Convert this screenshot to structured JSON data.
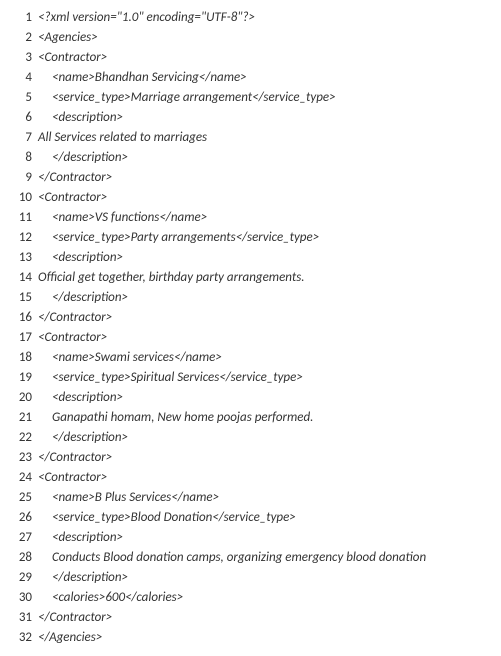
{
  "lines": [
    {
      "n": "1",
      "indent": 1,
      "text": "<?xml version=\"1.0\" encoding=\"UTF-8\"?>"
    },
    {
      "n": "2",
      "indent": 1,
      "text": "<Agencies>"
    },
    {
      "n": "3",
      "indent": 1,
      "text": "<Contractor>"
    },
    {
      "n": "4",
      "indent": 2,
      "text": "<name>Bhandhan Servicing</name>"
    },
    {
      "n": "5",
      "indent": 2,
      "text": "<service_type>Marriage arrangement</service_type>"
    },
    {
      "n": "6",
      "indent": 2,
      "text": "<description>"
    },
    {
      "n": "7",
      "indent": 1,
      "text": "All Services related to marriages"
    },
    {
      "n": "8",
      "indent": 2,
      "text": "</description>"
    },
    {
      "n": "9",
      "indent": 1,
      "text": "</Contractor>"
    },
    {
      "n": "10",
      "indent": 1,
      "text": "<Contractor>"
    },
    {
      "n": "11",
      "indent": 2,
      "text": "<name>VS functions</name>"
    },
    {
      "n": "12",
      "indent": 2,
      "text": "<service_type>Party arrangements</service_type>"
    },
    {
      "n": "13",
      "indent": 2,
      "text": "<description>"
    },
    {
      "n": "14",
      "indent": 1,
      "text": "Official get together, birthday party arrangements."
    },
    {
      "n": "15",
      "indent": 2,
      "text": "</description>"
    },
    {
      "n": "16",
      "indent": 1,
      "text": "</Contractor>"
    },
    {
      "n": "17",
      "indent": 1,
      "text": "<Contractor>"
    },
    {
      "n": "18",
      "indent": 2,
      "text": "<name>Swami services</name>"
    },
    {
      "n": "19",
      "indent": 2,
      "text": "<service_type>Spiritual Services</service_type>"
    },
    {
      "n": "20",
      "indent": 2,
      "text": "<description>"
    },
    {
      "n": "21",
      "indent": 2,
      "text": "Ganapathi homam, New home poojas performed."
    },
    {
      "n": "22",
      "indent": 2,
      "text": "</description>"
    },
    {
      "n": "23",
      "indent": 1,
      "text": "</Contractor>"
    },
    {
      "n": "24",
      "indent": 1,
      "text": "<Contractor>"
    },
    {
      "n": "25",
      "indent": 2,
      "text": "<name>B Plus Services</name>"
    },
    {
      "n": "26",
      "indent": 2,
      "text": "<service_type>Blood Donation</service_type>"
    },
    {
      "n": "27",
      "indent": 2,
      "text": "<description>"
    },
    {
      "n": "28",
      "indent": 2,
      "text": "Conducts Blood donation camps, organizing emergency blood donation"
    },
    {
      "n": "29",
      "indent": 2,
      "text": "</description>"
    },
    {
      "n": "30",
      "indent": 2,
      "text": "<calories>600</calories>"
    },
    {
      "n": "31",
      "indent": 1,
      "text": "</Contractor>"
    },
    {
      "n": "32",
      "indent": 1,
      "text": "</Agencies>"
    }
  ]
}
